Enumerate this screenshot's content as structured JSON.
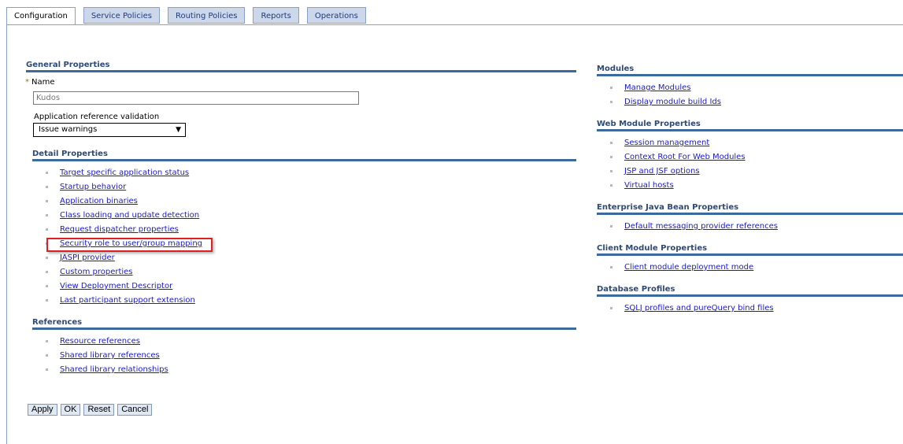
{
  "tabs": [
    {
      "label": "Configuration",
      "active": true
    },
    {
      "label": "Service Policies",
      "active": false
    },
    {
      "label": "Routing Policies",
      "active": false
    },
    {
      "label": "Reports",
      "active": false
    },
    {
      "label": "Operations",
      "active": false
    }
  ],
  "general": {
    "title": "General Properties",
    "name_label": "Name",
    "required_marker": "*",
    "name_value": "Kudos",
    "validation_label": "Application reference validation",
    "validation_value": "Issue warnings",
    "dropdown_arrow": "▼"
  },
  "detail": {
    "title": "Detail Properties",
    "items": [
      "Target specific application status",
      "Startup behavior",
      "Application binaries",
      "Class loading and update detection",
      "Request dispatcher properties",
      "Security role to user/group mapping",
      "JASPI provider",
      "Custom properties",
      "View Deployment Descriptor",
      "Last participant support extension"
    ],
    "highlighted_index": 5
  },
  "references": {
    "title": "References",
    "items": [
      "Resource references",
      "Shared library references",
      "Shared library relationships"
    ]
  },
  "modules": {
    "title": "Modules",
    "items": [
      "Manage Modules",
      "Display module build Ids"
    ]
  },
  "web_module": {
    "title": "Web Module Properties",
    "items": [
      "Session management",
      "Context Root For Web Modules",
      "JSP and JSF options",
      "Virtual hosts"
    ]
  },
  "ejb": {
    "title": "Enterprise Java Bean Properties",
    "items": [
      "Default messaging provider references"
    ]
  },
  "client_module": {
    "title": "Client Module Properties",
    "items": [
      "Client module deployment mode"
    ]
  },
  "database": {
    "title": "Database Profiles",
    "items": [
      "SQLJ profiles and pureQuery bind files"
    ]
  },
  "buttons": {
    "apply": "Apply",
    "ok": "OK",
    "reset": "Reset",
    "cancel": "Cancel"
  },
  "colors": {
    "link": "#1a1acc",
    "section_title": "#2d4a78",
    "section_rule": "#3c6a9c",
    "tab_bg": "#ccd7ea",
    "highlight": "#e02020"
  }
}
